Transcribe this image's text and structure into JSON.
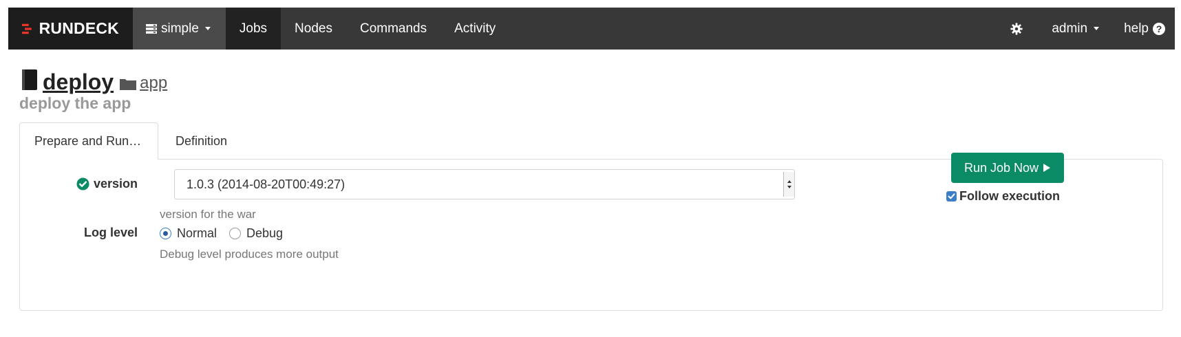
{
  "navbar": {
    "brand": "RUNDECK",
    "project": "simple",
    "items": [
      {
        "label": "Jobs",
        "active": true
      },
      {
        "label": "Nodes",
        "active": false
      },
      {
        "label": "Commands",
        "active": false
      },
      {
        "label": "Activity",
        "active": false
      }
    ],
    "settings_icon": "gear-icon",
    "user": "admin",
    "help": "help",
    "help_icon_glyph": "?"
  },
  "job": {
    "name": "deploy",
    "group": "app",
    "description": "deploy the app"
  },
  "tabs": [
    {
      "label": "Prepare and Run…",
      "active": true
    },
    {
      "label": "Definition",
      "active": false
    }
  ],
  "form": {
    "version": {
      "label": "version",
      "selected": "1.0.3 (2014-08-20T00:49:27)",
      "help": "version for the war"
    },
    "log_level": {
      "label": "Log level",
      "options": [
        "Normal",
        "Debug"
      ],
      "selected": "Normal",
      "help": "Debug level produces more output"
    },
    "run_button": "Run Job Now",
    "follow_execution": {
      "label": "Follow execution",
      "checked": true
    }
  },
  "colors": {
    "navbar": "#383838",
    "brand_bg": "#1d1d1d",
    "active_nav": "#222222",
    "brand_red": "#e8362b",
    "success": "#0b8a66",
    "check_blue": "#3c7fc6"
  }
}
